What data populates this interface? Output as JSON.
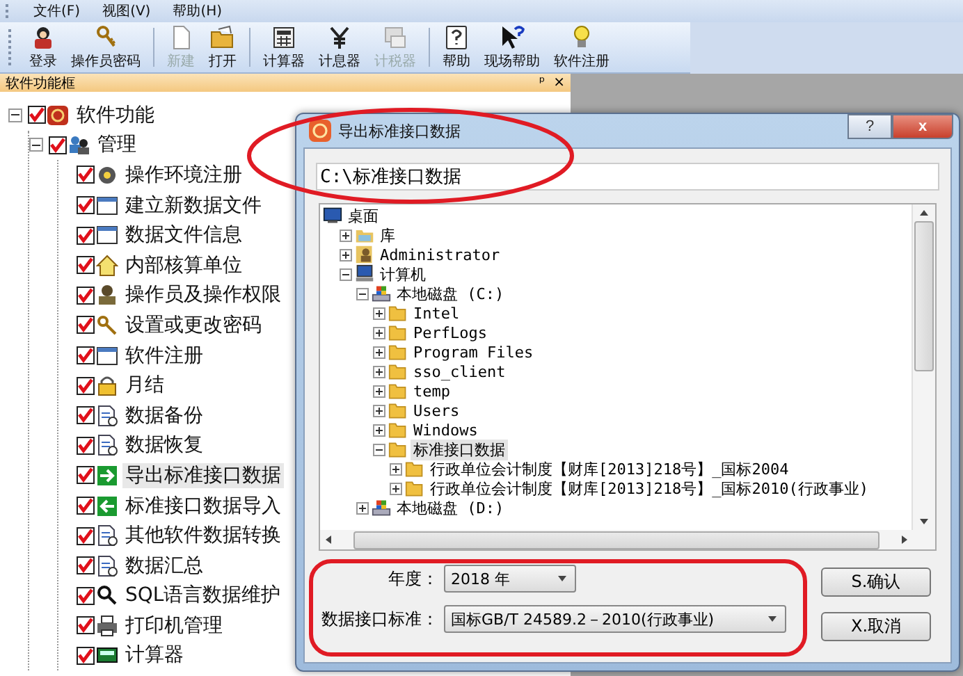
{
  "menu": [
    {
      "label": "文件(F)"
    },
    {
      "label": "视图(V)"
    },
    {
      "label": "帮助(H)"
    }
  ],
  "toolbar": [
    {
      "label": "登录",
      "kind": "person",
      "disabled": false
    },
    {
      "label": "操作员密码",
      "kind": "key",
      "disabled": false
    },
    {
      "kind": "separator"
    },
    {
      "label": "新建",
      "kind": "document",
      "disabled": true
    },
    {
      "label": "打开",
      "kind": "folder",
      "disabled": false
    },
    {
      "kind": "separator"
    },
    {
      "label": "计算器",
      "kind": "calculator",
      "disabled": false
    },
    {
      "label": "计息器",
      "kind": "yen",
      "disabled": false
    },
    {
      "label": "计税器",
      "kind": "screen",
      "disabled": true
    },
    {
      "kind": "separator"
    },
    {
      "label": "帮助",
      "kind": "help",
      "disabled": false
    },
    {
      "label": "现场帮助",
      "kind": "pointer",
      "disabled": false
    },
    {
      "label": "软件注册",
      "kind": "bulb",
      "disabled": false
    }
  ],
  "panel": {
    "title": "软件功能框",
    "pin": "ᵖ",
    "close": "×"
  },
  "tree": [
    {
      "label": "软件功能",
      "kind": "seal",
      "checked": true,
      "expanded": true,
      "selected": false,
      "children": [
        {
          "label": "管理",
          "kind": "users",
          "checked": true,
          "expanded": true,
          "selected": false,
          "children": [
            {
              "label": "操作环境注册",
              "kind": "gear",
              "checked": true,
              "selected": false
            },
            {
              "label": "建立新数据文件",
              "kind": "window",
              "checked": true,
              "selected": false
            },
            {
              "label": "数据文件信息",
              "kind": "window",
              "checked": true,
              "selected": false
            },
            {
              "label": "内部核算单位",
              "kind": "house",
              "checked": true,
              "selected": false
            },
            {
              "label": "操作员及操作权限",
              "kind": "person",
              "checked": true,
              "selected": false
            },
            {
              "label": "设置或更改密码",
              "kind": "key",
              "checked": true,
              "selected": false
            },
            {
              "label": "软件注册",
              "kind": "window",
              "checked": true,
              "selected": false
            },
            {
              "label": "月结",
              "kind": "lock",
              "checked": true,
              "selected": false
            },
            {
              "label": "数据备份",
              "kind": "doc",
              "checked": true,
              "selected": false
            },
            {
              "label": "数据恢复",
              "kind": "doc",
              "checked": true,
              "selected": false
            },
            {
              "label": "导出标准接口数据",
              "kind": "export",
              "checked": true,
              "selected": true
            },
            {
              "label": "标准接口数据导入",
              "kind": "import",
              "checked": true,
              "selected": false
            },
            {
              "label": "其他软件数据转换",
              "kind": "doc",
              "checked": true,
              "selected": false
            },
            {
              "label": "数据汇总",
              "kind": "doc",
              "checked": true,
              "selected": false
            },
            {
              "label": "SQL语言数据维护",
              "kind": "sql",
              "checked": true,
              "selected": false
            },
            {
              "label": "打印机管理",
              "kind": "printer",
              "checked": true,
              "selected": false
            },
            {
              "label": "计算器",
              "kind": "calc",
              "checked": true,
              "selected": false
            }
          ]
        }
      ]
    }
  ],
  "dialog": {
    "title": "导出标准接口数据",
    "help": "?",
    "close": "x",
    "path": "C:\\标准接口数据",
    "tree": [
      {
        "label": "桌面",
        "kind": "desktop",
        "selected": false,
        "children": [
          {
            "label": "库",
            "kind": "library",
            "expanded": false,
            "selected": false
          },
          {
            "label": "Administrator",
            "kind": "user",
            "expanded": false,
            "selected": false
          },
          {
            "label": "计算机",
            "kind": "computer",
            "expanded": true,
            "selected": false,
            "children": [
              {
                "label": "本地磁盘 (C:)",
                "kind": "drive",
                "expanded": true,
                "selected": false,
                "children": [
                  {
                    "label": "Intel",
                    "kind": "folder",
                    "expanded": false,
                    "selected": false
                  },
                  {
                    "label": "PerfLogs",
                    "kind": "folder",
                    "expanded": false,
                    "selected": false
                  },
                  {
                    "label": "Program Files",
                    "kind": "folder",
                    "expanded": false,
                    "selected": false
                  },
                  {
                    "label": "sso_client",
                    "kind": "folder",
                    "expanded": false,
                    "selected": false
                  },
                  {
                    "label": "temp",
                    "kind": "folder",
                    "expanded": false,
                    "selected": false
                  },
                  {
                    "label": "Users",
                    "kind": "folder",
                    "expanded": false,
                    "selected": false
                  },
                  {
                    "label": "Windows",
                    "kind": "folder",
                    "expanded": false,
                    "selected": false
                  },
                  {
                    "label": "标准接口数据",
                    "kind": "folder",
                    "expanded": true,
                    "selected": true,
                    "children": [
                      {
                        "label": "行政单位会计制度【财库[2013]218号】_国标2004",
                        "kind": "folder",
                        "expanded": false,
                        "selected": false
                      },
                      {
                        "label": "行政单位会计制度【财库[2013]218号】_国标2010(行政事业)",
                        "kind": "folder",
                        "expanded": false,
                        "selected": false
                      }
                    ]
                  }
                ]
              },
              {
                "label": "本地磁盘 (D:)",
                "kind": "drive",
                "expanded": false,
                "selected": false
              }
            ]
          }
        ]
      }
    ],
    "year_label": "年度：",
    "year": "2018 年",
    "standard_label": "数据接口标准：",
    "standard": "国标GB/T 24589.2－2010(行政事业)",
    "buttons": [
      {
        "label": "S.确认"
      },
      {
        "label": "X.取消"
      }
    ]
  }
}
